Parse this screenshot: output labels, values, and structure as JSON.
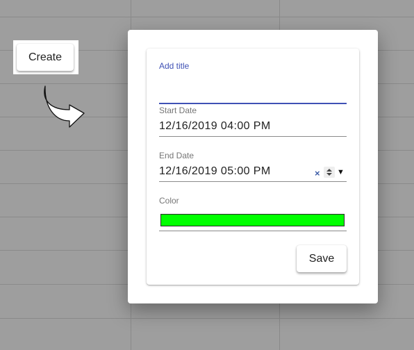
{
  "toolbar": {
    "create_label": "Create"
  },
  "form": {
    "title": {
      "label": "Add title",
      "value": ""
    },
    "start_date": {
      "label": "Start Date",
      "value": "12/16/2019 04:00 PM"
    },
    "end_date": {
      "label": "End Date",
      "value": "12/16/2019 05:00 PM",
      "clear_glyph": "×",
      "dropdown_glyph": "▼"
    },
    "color": {
      "label": "Color",
      "value": "#00ff00"
    },
    "save_label": "Save"
  },
  "colors": {
    "accent": "#3f51b5",
    "backdrop": "#9e9e9e"
  }
}
